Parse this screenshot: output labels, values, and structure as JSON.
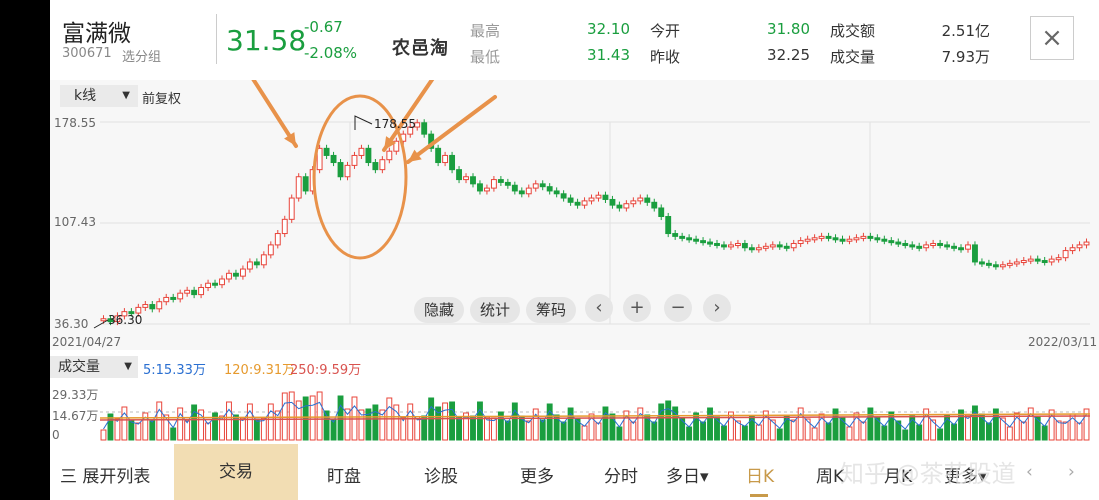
{
  "stock": {
    "name": "富满微",
    "code": "300671",
    "group": "选分组",
    "price": "31.58",
    "change": "-0.67",
    "change_pct": "-2.08%"
  },
  "watermark_logo": "农邑淘",
  "watermark_bottom": "知乎 @茶花股道",
  "quote": {
    "high_label": "最高",
    "high": "32.10",
    "low_label": "最低",
    "low": "31.43",
    "open_label": "今开",
    "open": "31.80",
    "prev_label": "昨收",
    "prev": "32.25",
    "amount_label": "成交额",
    "amount": "2.51亿",
    "volume_label": "成交量",
    "volume": "7.93万"
  },
  "close_icon": "×",
  "kline": {
    "type_label": "k线",
    "adjust_label": "前复权",
    "y_max": "178.55",
    "y_mid": "107.43",
    "y_min": "36.30",
    "peak_label": "178.55",
    "trough_label": "36.30",
    "date_start": "2021/04/27",
    "date_end": "2022/03/11",
    "controls": [
      "隐藏",
      "统计",
      "筹码"
    ],
    "icons": [
      "‹",
      "+",
      "−",
      "›"
    ]
  },
  "volume": {
    "label": "成交量",
    "ma5": "5:15.33万",
    "ma120": "120:9.31万",
    "ma250": "250:9.59万",
    "y_max": "29.33万",
    "y_mid": "14.67万",
    "y_min": "0"
  },
  "bottom": {
    "expand": "三 展开列表",
    "trade": "交易",
    "tabs": [
      "盯盘",
      "诊股",
      "更多",
      "分时",
      "多日▾",
      "日K",
      "周K",
      "月K",
      "更多▾"
    ]
  },
  "colors": {
    "up": "#e8443a",
    "down": "#1a9e3f",
    "accent": "#c89a4a",
    "annotation": "#e8924a"
  },
  "chart_data": {
    "type": "candlestick",
    "x": [
      "2021/04/27",
      "2022/03/11"
    ],
    "ylim": [
      36.3,
      178.55
    ],
    "closes": [
      40,
      38,
      42,
      45,
      44,
      48,
      50,
      47,
      52,
      55,
      54,
      58,
      60,
      57,
      62,
      65,
      64,
      68,
      72,
      70,
      75,
      80,
      78,
      85,
      92,
      100,
      110,
      125,
      140,
      130,
      145,
      160,
      155,
      150,
      140,
      148,
      155,
      160,
      150,
      145,
      152,
      158,
      165,
      170,
      175,
      178,
      170,
      160,
      150,
      155,
      145,
      138,
      140,
      135,
      130,
      132,
      138,
      136,
      134,
      130,
      128,
      132,
      135,
      133,
      130,
      128,
      125,
      122,
      120,
      123,
      125,
      127,
      124,
      120,
      118,
      121,
      123,
      125,
      122,
      118,
      112,
      100,
      98,
      97,
      96,
      95,
      94,
      93,
      92,
      91,
      92,
      93,
      90,
      89,
      90,
      91,
      92,
      91,
      90,
      93,
      95,
      96,
      97,
      98,
      97,
      96,
      95,
      96,
      97,
      98,
      97,
      96,
      95,
      94,
      93,
      92,
      91,
      90,
      92,
      93,
      92,
      91,
      90,
      89,
      92,
      80,
      79,
      78,
      77,
      78,
      79,
      80,
      81,
      82,
      81,
      80,
      82,
      83,
      88,
      90,
      92,
      94
    ]
  }
}
